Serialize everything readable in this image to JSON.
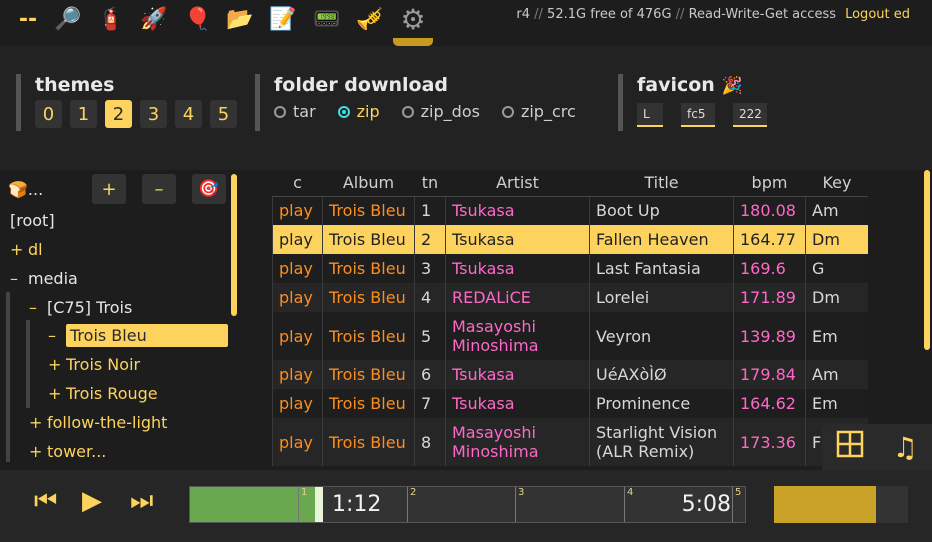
{
  "topbar": {
    "dash": "--",
    "icons": [
      {
        "name": "search-icon",
        "glyph": "🔎"
      },
      {
        "name": "extinguisher-icon",
        "glyph": "🧯"
      },
      {
        "name": "rocket-icon",
        "glyph": "🚀"
      },
      {
        "name": "balloon-icon",
        "glyph": "🎈"
      },
      {
        "name": "folder-icon",
        "glyph": "📂"
      },
      {
        "name": "notepad-icon",
        "glyph": "📝"
      },
      {
        "name": "card-icon",
        "glyph": "📟"
      },
      {
        "name": "trumpet-icon",
        "glyph": "🎺"
      },
      {
        "name": "gear-icon",
        "glyph": "⚙"
      }
    ],
    "server": "r4",
    "sep": "//",
    "free": "52.1G free of 476G",
    "access": "Read-Write-Get access",
    "logout": "Logout ed"
  },
  "settings": {
    "themes": {
      "label": "themes",
      "options": [
        "0",
        "1",
        "2",
        "3",
        "4",
        "5"
      ],
      "selected": "2"
    },
    "download": {
      "label": "folder download",
      "options": [
        "tar",
        "zip",
        "zip_dos",
        "zip_crc"
      ],
      "selected": "zip"
    },
    "favicon": {
      "label": "favicon",
      "glyph": "🎉",
      "fields": [
        "L",
        "fc5",
        "222"
      ]
    }
  },
  "tree": {
    "toolbar": {
      "label": "🍞...",
      "plus": "+",
      "minus": "–",
      "target": "🎯"
    },
    "nodes": [
      {
        "pm": "",
        "name": "[root]"
      },
      {
        "pm": "+",
        "name": "dl"
      },
      {
        "pm": "–",
        "name": "media"
      },
      {
        "pm": "–",
        "name": "[C75] Trois"
      },
      {
        "pm": "–",
        "name": "Trois Bleu"
      },
      {
        "pm": "+",
        "name": "Trois Noir"
      },
      {
        "pm": "+",
        "name": "Trois Rouge"
      },
      {
        "pm": "+",
        "name": "follow-the-light"
      },
      {
        "pm": "+",
        "name": "tower..."
      }
    ]
  },
  "playlist": {
    "columns": [
      "c",
      "Album",
      "tn",
      "Artist",
      "Title",
      "bpm",
      "Key"
    ],
    "rows": [
      {
        "c": "play",
        "album": "Trois Bleu",
        "tn": "1",
        "artist": "Tsukasa",
        "title": "Boot Up",
        "bpm": "180.08",
        "key": "Am"
      },
      {
        "c": "play",
        "album": "Trois Bleu",
        "tn": "2",
        "artist": "Tsukasa",
        "title": "Fallen Heaven",
        "bpm": "164.77",
        "key": "Dm"
      },
      {
        "c": "play",
        "album": "Trois Bleu",
        "tn": "3",
        "artist": "Tsukasa",
        "title": "Last Fantasia",
        "bpm": "169.6",
        "key": "G"
      },
      {
        "c": "play",
        "album": "Trois Bleu",
        "tn": "4",
        "artist": "REDALiCE",
        "title": "Lorelei",
        "bpm": "171.89",
        "key": "Dm"
      },
      {
        "c": "play",
        "album": "Trois Bleu",
        "tn": "5",
        "artist": "Masayoshi Minoshima",
        "title": "Veyron",
        "bpm": "139.89",
        "key": "Em"
      },
      {
        "c": "play",
        "album": "Trois Bleu",
        "tn": "6",
        "artist": "Tsukasa",
        "title": "UéAXòÌØ",
        "bpm": "179.84",
        "key": "Am"
      },
      {
        "c": "play",
        "album": "Trois Bleu",
        "tn": "7",
        "artist": "Tsukasa",
        "title": "Prominence",
        "bpm": "164.62",
        "key": "Em"
      },
      {
        "c": "play",
        "album": "Trois Bleu",
        "tn": "8",
        "artist": "Masayoshi Minoshima",
        "title": "Starlight Vision (ALR Remix)",
        "bpm": "173.36",
        "key": "F"
      }
    ]
  },
  "view_buttons": {
    "grid": "grid-icon",
    "music": "music-note-icon"
  },
  "player": {
    "prev": "⏮",
    "play": "▶",
    "next": "⏭",
    "elapsed": "1:12",
    "duration": "5:08",
    "progress": 0.233,
    "marks": [
      "1",
      "2",
      "3",
      "4",
      "5"
    ],
    "volume": 0.76
  }
}
